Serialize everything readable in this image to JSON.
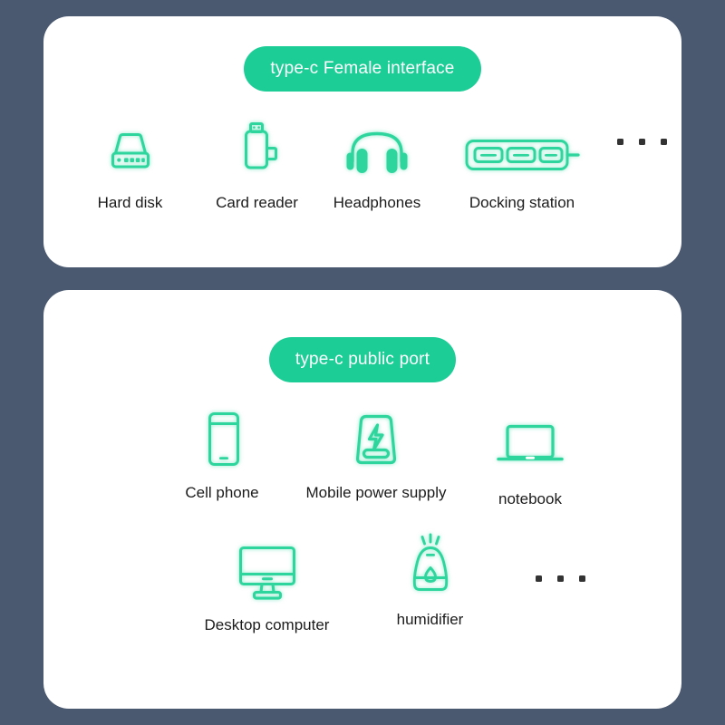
{
  "theme": {
    "background": "#4a5870",
    "card_background": "#ffffff",
    "pill_green": "#1ccd95",
    "icon_green": "#2ed69e",
    "label_color": "#1b1b1b",
    "dot_color": "#333333"
  },
  "sections": [
    {
      "id": "female",
      "pill_label": "type-c Female interface",
      "rows": [
        {
          "items": [
            {
              "icon": "hard-disk-icon",
              "label": "Hard disk"
            },
            {
              "icon": "card-reader-icon",
              "label": "Card reader"
            },
            {
              "icon": "headphones-icon",
              "label": "Headphones"
            },
            {
              "icon": "docking-station-icon",
              "label": "Docking station"
            }
          ],
          "trailing_ellipsis": true
        }
      ]
    },
    {
      "id": "public",
      "pill_label": "type-c public port",
      "rows": [
        {
          "items": [
            {
              "icon": "cell-phone-icon",
              "label": "Cell phone"
            },
            {
              "icon": "power-bank-icon",
              "label": "Mobile power supply"
            },
            {
              "icon": "notebook-icon",
              "label": "notebook"
            }
          ],
          "trailing_ellipsis": false
        },
        {
          "items": [
            {
              "icon": "desktop-computer-icon",
              "label": "Desktop computer"
            },
            {
              "icon": "humidifier-icon",
              "label": "humidifier"
            }
          ],
          "trailing_ellipsis": true
        }
      ]
    }
  ],
  "ellipsis": {
    "dot_count": 3,
    "aria_label": "more items"
  }
}
